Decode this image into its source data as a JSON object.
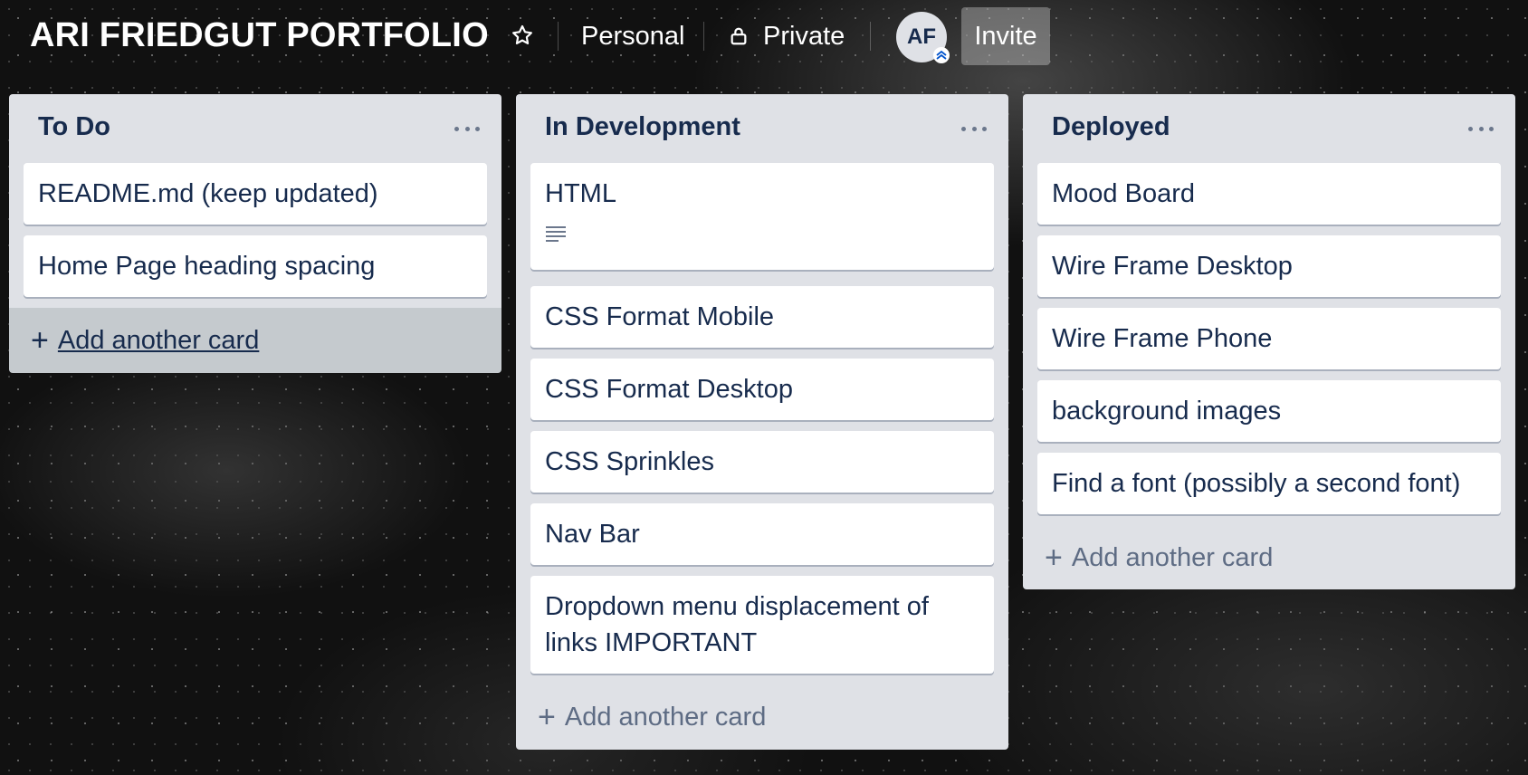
{
  "header": {
    "board_title": "ARI FRIEDGUT PORTFOLIO",
    "workspace_label": "Personal",
    "visibility_label": "Private",
    "avatar_initials": "AF",
    "invite_label": "Invite"
  },
  "lists": [
    {
      "title": "To Do",
      "cards": [
        "README.md (keep updated)",
        "Home Page heading spacing"
      ],
      "add_label": "Add another card"
    },
    {
      "title": "In Development",
      "cards": [
        "HTML",
        "CSS Format Mobile",
        "CSS Format Desktop",
        "CSS Sprinkles",
        "Nav Bar",
        "Dropdown menu displacement of links IMPORTANT"
      ],
      "add_label": "Add another card"
    },
    {
      "title": "Deployed",
      "cards": [
        "Mood Board",
        "Wire Frame Desktop",
        "Wire Frame Phone",
        "background images",
        "Find a font (possibly a second font)"
      ],
      "add_label": "Add another card"
    }
  ],
  "colors": {
    "list_bg": "#dfe1e6",
    "card_bg": "#ffffff",
    "text": "#172b4d",
    "muted_text": "#5e6c84",
    "header_text": "#ffffff"
  },
  "icons": {
    "star": "star-icon",
    "lock": "lock-icon",
    "list_menu": "more-horizontal-icon",
    "description": "description-icon",
    "add": "plus-icon"
  }
}
